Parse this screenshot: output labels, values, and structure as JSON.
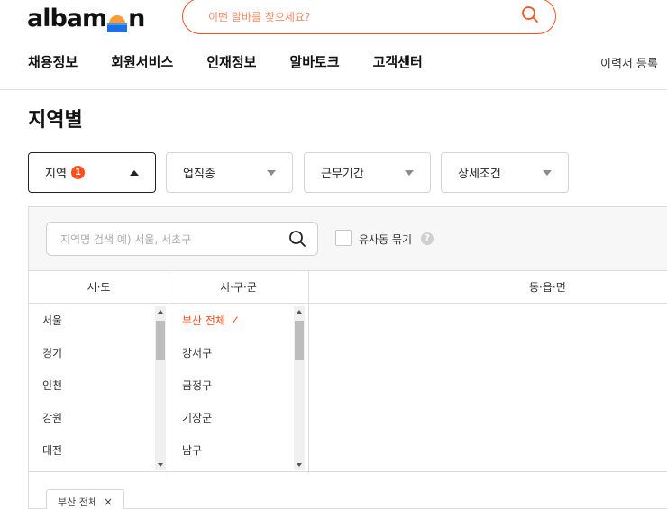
{
  "brand": {
    "logo_text_left": "albam",
    "logo_text_right": "n",
    "accent": "#ff501b"
  },
  "search": {
    "placeholder": "이떤 알바를 찾으세요?",
    "icon": "search-icon"
  },
  "gnb": {
    "items": [
      "채용정보",
      "회원서비스",
      "인재정보",
      "알바토크",
      "고객센터"
    ]
  },
  "header_links": {
    "resume": "이력서 등록"
  },
  "page": {
    "title": "지역별"
  },
  "filters": [
    {
      "label": "지역",
      "badge": "1",
      "state": "open"
    },
    {
      "label": "업직종",
      "state": "closed"
    },
    {
      "label": "근무기간",
      "state": "closed"
    },
    {
      "label": "상세조건",
      "state": "closed"
    }
  ],
  "region": {
    "search_placeholder": "지역명 검색 예) 서울, 서초구",
    "similar_label": "유사동 묶기",
    "help": "?",
    "columns": {
      "sido": "시·도",
      "sigungu": "시·구·군",
      "dong": "동·읍·면"
    },
    "sido": [
      "서울",
      "경기",
      "인천",
      "강원",
      "대전"
    ],
    "sigungu": [
      {
        "label": "부산 전체",
        "selected": true,
        "check": "✓"
      },
      {
        "label": "강서구"
      },
      {
        "label": "금정구"
      },
      {
        "label": "기장군"
      },
      {
        "label": "남구"
      }
    ],
    "selected_chip": {
      "label": "부산 전체",
      "close": "×"
    }
  }
}
